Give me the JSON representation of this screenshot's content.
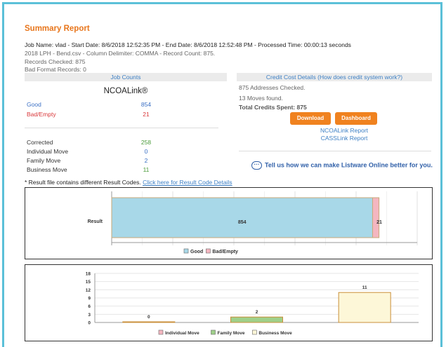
{
  "report": {
    "title": "Summary Report",
    "job_line": "Job Name: vlad - Start Date: 8/6/2018 12:52:35 PM - End Date: 8/6/2018 12:52:48 PM - Processed Time: 00:00:13 seconds",
    "file_line": "2018 LPH - Bend.csv - Column Delimiter: COMMA - Record Count: 875.",
    "records_checked": "Records Checked: 875",
    "bad_format": "Bad Format Records: 0"
  },
  "job_counts": {
    "header": "Job Counts",
    "product": "NCOALink®",
    "rows_top": [
      {
        "label": "Good",
        "value": "854",
        "color": "#3a6fc4"
      },
      {
        "label": "Bad/Empty",
        "value": "21",
        "color": "#d9383a"
      }
    ],
    "rows_bottom": [
      {
        "label": "Corrected",
        "value": "258",
        "color": "#4a9a3a"
      },
      {
        "label": "Individual Move",
        "value": "0",
        "color": "#3a6fc4"
      },
      {
        "label": "Family Move",
        "value": "2",
        "color": "#3a6fc4"
      },
      {
        "label": "Business Move",
        "value": "11",
        "color": "#4a9a3a"
      }
    ]
  },
  "credits": {
    "header": "Credit Cost Details",
    "header_link": "(How does credit system work?)",
    "addresses_checked": "875 Addresses Checked.",
    "moves_found": "13 Moves found.",
    "total_spent": "Total Credits Spent: 875",
    "download_label": "Download",
    "dashboard_label": "Dashboard",
    "ncoa_report": "NCOALink Report",
    "cass_report": "CASSLink Report",
    "feedback": "Tell us how we can make Listware Online better for you."
  },
  "note": {
    "text": "* Result file contains different Result Codes.",
    "link": "Click here for Result Code Details"
  },
  "chart_data": [
    {
      "type": "bar",
      "orientation": "horizontal",
      "stacked": true,
      "categories": [
        "Result"
      ],
      "series": [
        {
          "name": "Good",
          "values": [
            854
          ],
          "color": "#a8d8e8"
        },
        {
          "name": "Bad/Empty",
          "values": [
            21
          ],
          "color": "#f4b6c0"
        }
      ],
      "xlim": [
        0,
        1000
      ],
      "grid": true,
      "legend": "bottom"
    },
    {
      "type": "bar",
      "categories": [
        "Individual Move",
        "Family Move",
        "Business Move"
      ],
      "series": [
        {
          "name": "Individual Move",
          "values": [
            0
          ],
          "color": "#f4b6c0"
        },
        {
          "name": "Family Move",
          "values": [
            2
          ],
          "color": "#9fd08a"
        },
        {
          "name": "Business Move",
          "values": [
            11
          ],
          "color": "#fdf7d8"
        }
      ],
      "yticks": [
        "0",
        "3",
        "6",
        "9",
        "12",
        "15",
        "18"
      ],
      "ylim": [
        0,
        18
      ],
      "grid": true,
      "legend": "bottom"
    }
  ]
}
